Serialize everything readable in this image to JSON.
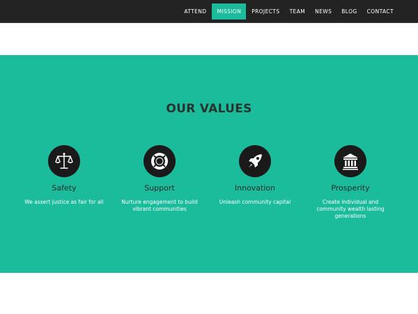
{
  "nav": {
    "items": [
      {
        "label": "ATTEND"
      },
      {
        "label": "MISSION"
      },
      {
        "label": "PROJECTS"
      },
      {
        "label": "TEAM"
      },
      {
        "label": "NEWS"
      },
      {
        "label": "BLOG"
      },
      {
        "label": "CONTACT"
      }
    ],
    "active_index": 1,
    "active_color": "#1abc9c",
    "background": "#232323"
  },
  "values_section": {
    "title": "OUR VALUES",
    "background": "#1abc9c",
    "items": [
      {
        "icon": "scales-icon",
        "title": "Safety",
        "description": "We assert justice as fair for all"
      },
      {
        "icon": "lifebuoy-icon",
        "title": "Support",
        "description": "Nurture engagement to build vibrant communities"
      },
      {
        "icon": "rocket-icon",
        "title": "Innovation",
        "description": "Unleash community capital"
      },
      {
        "icon": "bank-icon",
        "title": "Prosperity",
        "description": "Create individual and community wealth lasting generations"
      }
    ]
  }
}
